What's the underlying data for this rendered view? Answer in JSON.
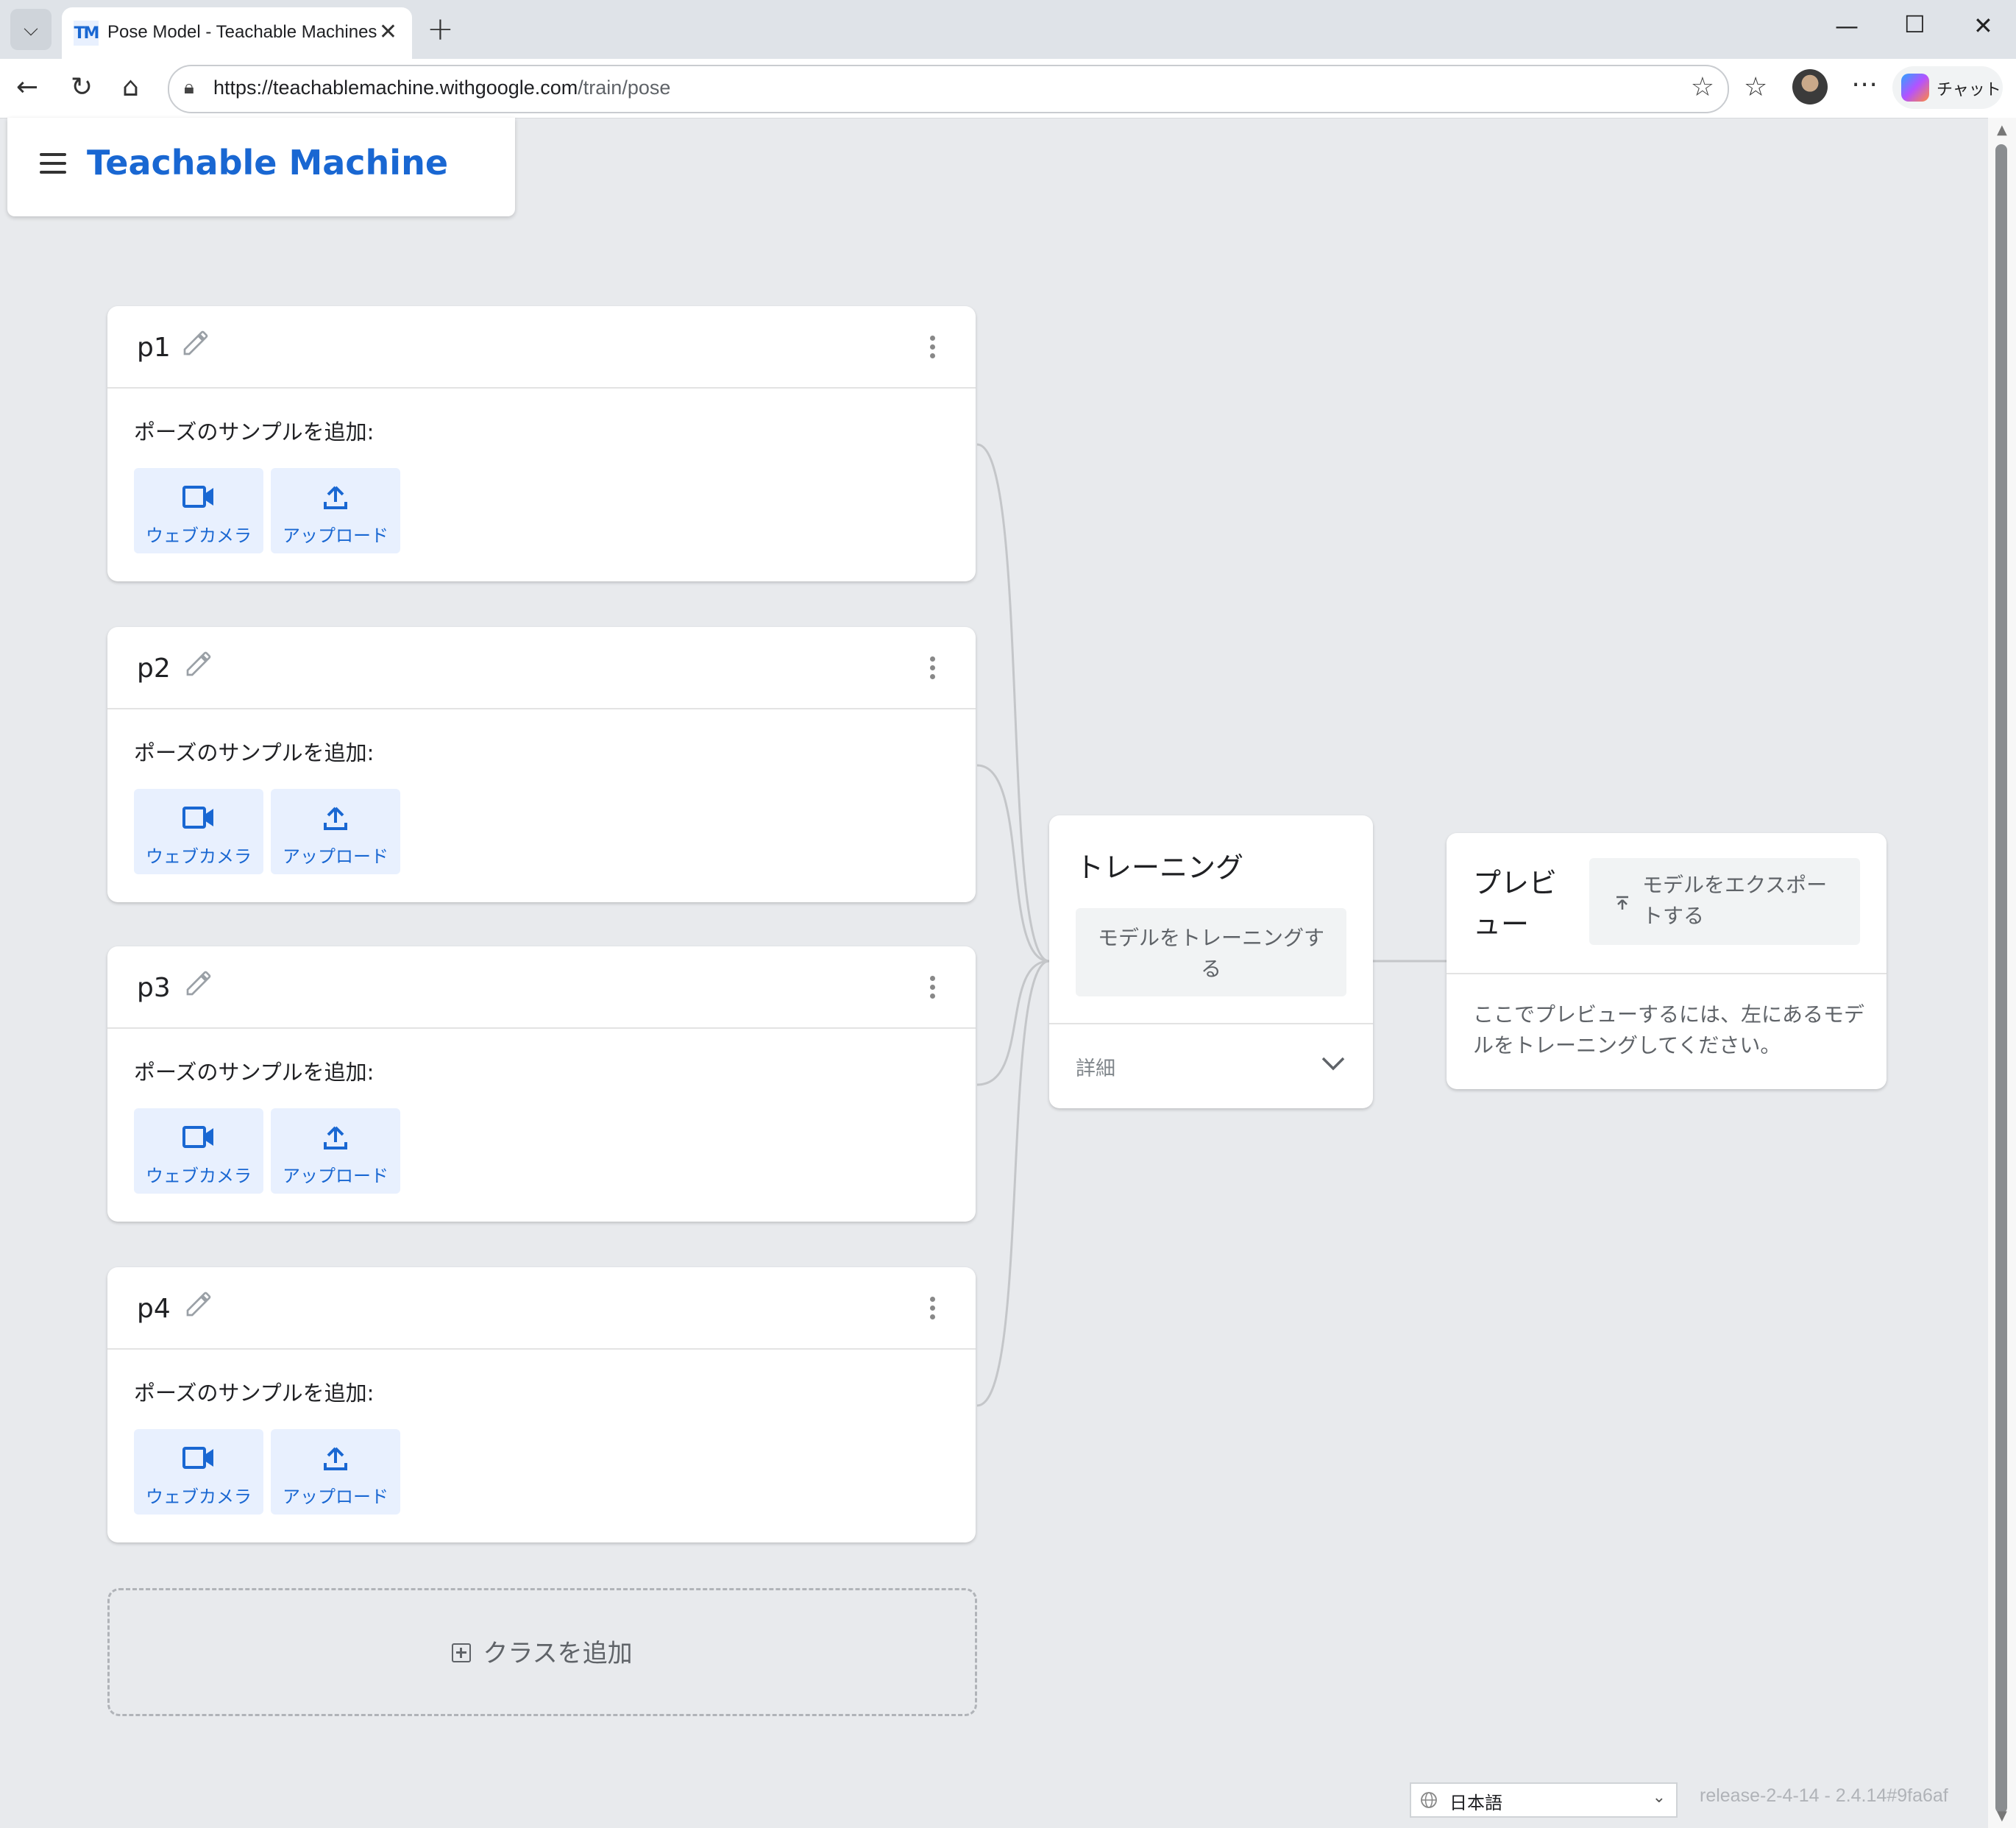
{
  "browser": {
    "tab_title": "Pose Model - Teachable Machines",
    "tab_favicon": "TM",
    "url_host": "https://teachablemachine.withgoogle.com",
    "url_path": "/train/pose",
    "copilot_label": "チャット"
  },
  "header": {
    "title": "Teachable Machine"
  },
  "classes": [
    {
      "name": "p1",
      "sample_label": "ポーズのサンプルを追加:",
      "webcam_label": "ウェブカメラ",
      "upload_label": "アップロード"
    },
    {
      "name": "p2",
      "sample_label": "ポーズのサンプルを追加:",
      "webcam_label": "ウェブカメラ",
      "upload_label": "アップロード"
    },
    {
      "name": "p3",
      "sample_label": "ポーズのサンプルを追加:",
      "webcam_label": "ウェブカメラ",
      "upload_label": "アップロード"
    },
    {
      "name": "p4",
      "sample_label": "ポーズのサンプルを追加:",
      "webcam_label": "ウェブカメラ",
      "upload_label": "アップロード"
    }
  ],
  "add_class_label": "クラスを追加",
  "training": {
    "title": "トレーニング",
    "train_button": "モデルをトレーニングする",
    "advanced_label": "詳細"
  },
  "preview": {
    "title": "プレビュー",
    "export_button": "モデルをエクスポートする",
    "message": "ここでプレビューするには、左にあるモデルをトレーニングしてください。"
  },
  "footer": {
    "language": "日本語",
    "version": "release-2-4-14 - 2.4.14#9fa6af"
  },
  "colors": {
    "accent": "#1967d2",
    "sample_button_bg": "#e8f0fe",
    "page_bg": "#e8eaed"
  }
}
